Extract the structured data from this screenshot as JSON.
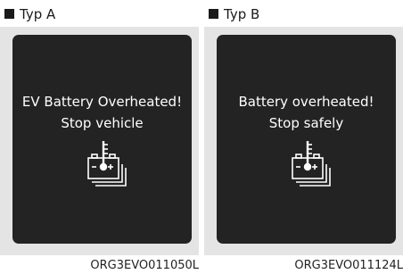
{
  "panels": [
    {
      "label": "Typ A",
      "line1": "EV Battery Overheated!",
      "line2": "Stop vehicle",
      "icon": "battery-overheat-icon",
      "code": "ORG3EVO011050L"
    },
    {
      "label": "Typ B",
      "line1": "Battery overheated!",
      "line2": "Stop safely",
      "icon": "battery-overheat-icon",
      "code": "ORG3EVO011124L"
    }
  ],
  "colors": {
    "screen": "#232323",
    "card": "#e4e4e4",
    "text_on_screen": "#ffffff"
  }
}
